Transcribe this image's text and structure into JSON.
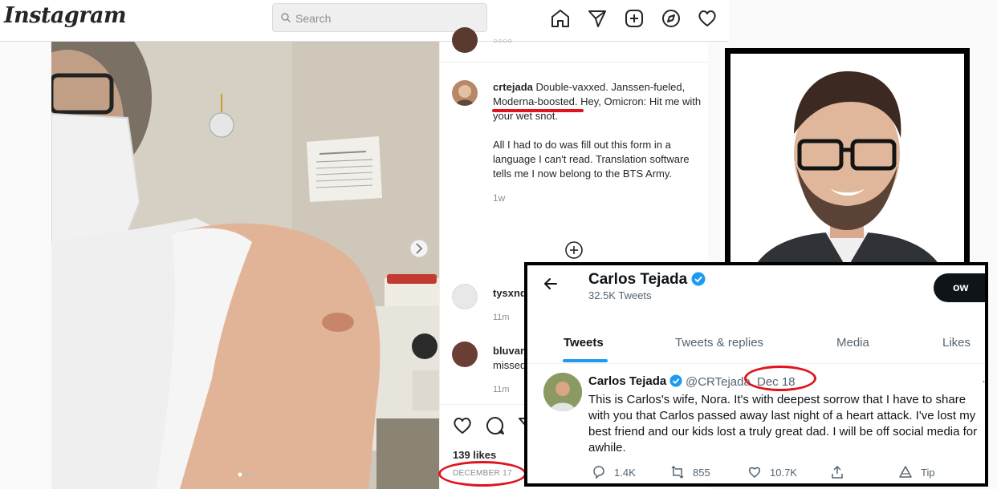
{
  "instagram": {
    "logo": "Instagram",
    "search_placeholder": "Search",
    "nav_icons": [
      "home-icon",
      "direct-icon",
      "new-post-icon",
      "explore-icon",
      "activity-icon"
    ],
    "caption": {
      "username": "crtejada",
      "text_part1": "Double-vaxxed. Janssen-fueled, ",
      "text_highlight": "Moderna-boosted",
      "text_part2": ". Hey, Omicron: Hit me with your wet snot.",
      "paragraph2": "All I had to do was fill out this form in a language I can't read. Translation software tells me I now belong to the BTS Army.",
      "time": "1w"
    },
    "comments": [
      {
        "username": "tysxnd",
        "text": "",
        "time": "11m"
      },
      {
        "username": "bluvar",
        "text": "missed",
        "time": "11m"
      }
    ],
    "likes": "139 likes",
    "date": "DECEMBER 17"
  },
  "twitter": {
    "profile_name": "Carlos Tejada",
    "tweet_count": "32.5K Tweets",
    "follow_partial": "ow",
    "tabs": [
      {
        "label": "Tweets",
        "active": true
      },
      {
        "label": "Tweets & replies",
        "active": false
      },
      {
        "label": "Media",
        "active": false
      },
      {
        "label": "Likes",
        "active": false
      }
    ],
    "tweet": {
      "author": "Carlos Tejada",
      "handle": "@CRTejada",
      "separator": "·",
      "date": "Dec 18",
      "body": "This is Carlos's wife, Nora. It's with deepest sorrow that I have to share with you that Carlos passed away last night of a heart attack. I've lost my best friend and our kids lost a truly great dad. I will be off social media for awhile.",
      "replies": "1.4K",
      "retweets": "855",
      "likes": "10.7K",
      "tip": "Tip"
    }
  },
  "colors": {
    "annotation_red": "#e0141e",
    "twitter_blue": "#1d9bf0",
    "instagram_border": "#dbdbdb"
  }
}
